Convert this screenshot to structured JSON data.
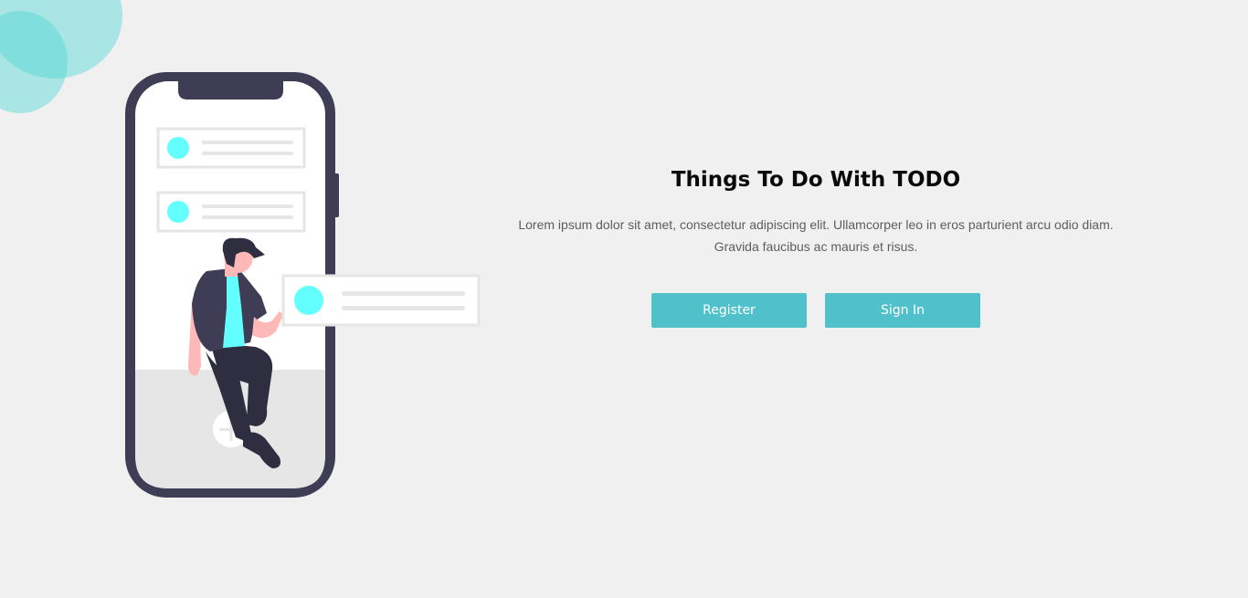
{
  "colors": {
    "background": "#f0f0f0",
    "accent": "#50c1cb",
    "blob": "#4fd8d4",
    "phone_frame": "#3f3d56",
    "card_dot": "#63ffff"
  },
  "illustration": {
    "icons": [
      "phone-icon",
      "person-icon",
      "plus-icon",
      "todo-card-icon"
    ]
  },
  "hero": {
    "title": "Things To Do With TODO",
    "description": "Lorem ipsum dolor sit amet, consectetur adipiscing elit. Ullamcorper leo in eros parturient arcu odio diam. Gravida faucibus ac mauris et risus."
  },
  "actions": {
    "register_label": "Register",
    "signin_label": "Sign In"
  }
}
